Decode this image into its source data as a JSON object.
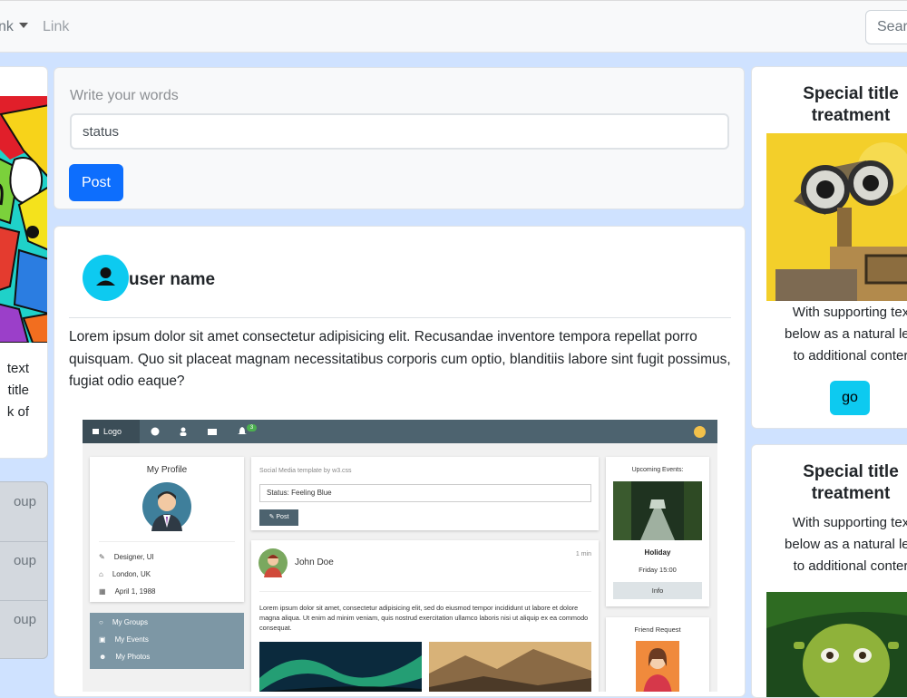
{
  "navbar": {
    "dropdown_label": "nk",
    "link_label": "Link",
    "search_placeholder": "Searc"
  },
  "left_column": {
    "card_text_lines": [
      "text",
      "title",
      "k of"
    ],
    "list_items": [
      "oup",
      "oup",
      "oup"
    ]
  },
  "post_form": {
    "label": "Write your words",
    "status_value": "status",
    "post_button": "Post"
  },
  "post": {
    "username": "user name",
    "body": "Lorem ipsum dolor sit amet consectetur adipisicing elit. Recusandae inventore tempora repellat porro quisquam. Quo sit placeat magnam necessitatibus corporis cum optio, blanditiis labore sint fugit possimus, fugiat odio eaque?",
    "screenshot": {
      "logo": "Logo",
      "notification_count": "3",
      "profile_title": "My Profile",
      "profile_role": "Designer, UI",
      "profile_location": "London, UK",
      "profile_birthday": "April 1, 1988",
      "menu_groups": "My Groups",
      "menu_events": "My Events",
      "menu_photos": "My Photos",
      "template_label": "Social Media template by w3.css",
      "status_text": "Status: Feeling Blue",
      "post_button": "Post",
      "author": "John Doe",
      "time": "1 min",
      "post_text": "Lorem ipsum dolor sit amet, consectetur adipisicing elit, sed do eiusmod tempor incididunt ut labore et dolore magna aliqua. Ut enim ad minim veniam, quis nostrud exercitation ullamco laboris nisi ut aliquip ex ea commodo consequat.",
      "events_title": "Upcoming Events:",
      "event_name": "Holiday",
      "event_time": "Friday 15:00",
      "info_button": "Info",
      "friend_request": "Friend Request"
    }
  },
  "right_column": {
    "card1": {
      "title_line1": "Special title",
      "title_line2": "treatment",
      "text_lines": [
        "With supporting tex",
        "below as a natural lea",
        "to additional conter"
      ],
      "button": "go"
    },
    "card2": {
      "title_line1": "Special title",
      "title_line2": "treatment",
      "text_lines": [
        "With supporting tex",
        "below as a natural lea",
        "to additional conter"
      ]
    }
  },
  "colors": {
    "page_background": "#cfe2ff",
    "primary": "#0d6efd",
    "info": "#0dcaf0",
    "w3_topbar": "#4d636f",
    "w3_sidebar": "#7d97a5"
  }
}
